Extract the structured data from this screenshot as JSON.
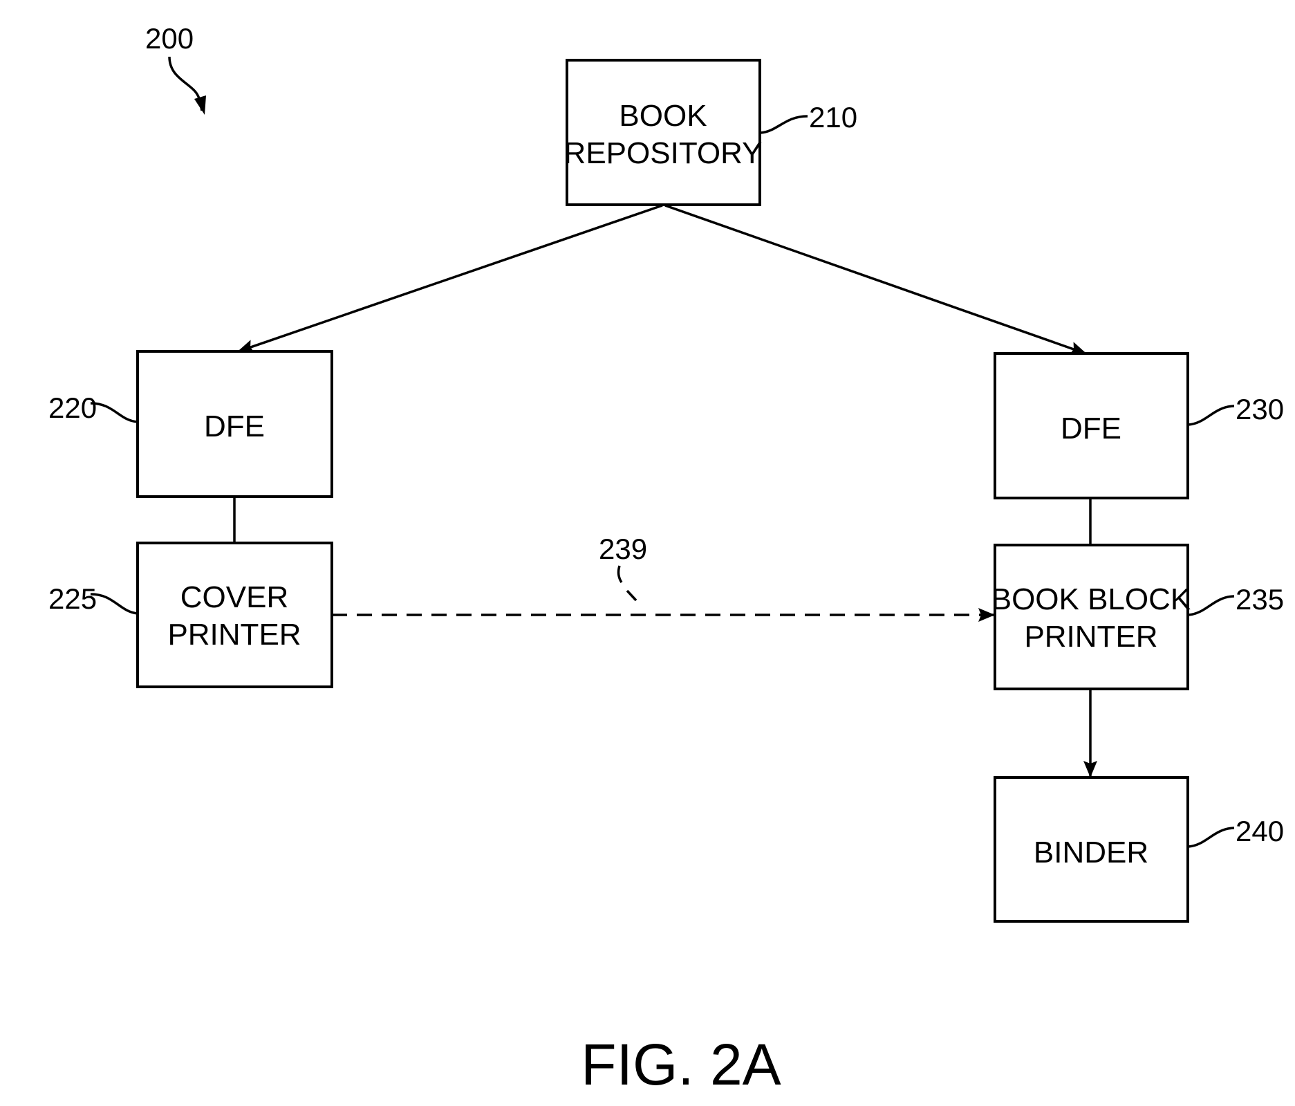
{
  "figure": {
    "ref": "200",
    "caption": "FIG. 2A"
  },
  "nodes": {
    "repository": {
      "ref": "210",
      "lines": [
        "BOOK",
        "REPOSITORY"
      ]
    },
    "dfe_left": {
      "ref": "220",
      "lines": [
        "DFE"
      ]
    },
    "cover_printer": {
      "ref": "225",
      "lines": [
        "COVER",
        "PRINTER"
      ]
    },
    "dfe_right": {
      "ref": "230",
      "lines": [
        "DFE"
      ]
    },
    "book_block_printer": {
      "ref": "235",
      "lines": [
        "BOOK BLOCK",
        "PRINTER"
      ]
    },
    "binder": {
      "ref": "240",
      "lines": [
        "BINDER"
      ]
    }
  },
  "edges": {
    "cover_to_book_block": {
      "ref": "239",
      "style": "dashed"
    }
  },
  "colors": {
    "ink": "#000000",
    "paper": "#ffffff"
  }
}
